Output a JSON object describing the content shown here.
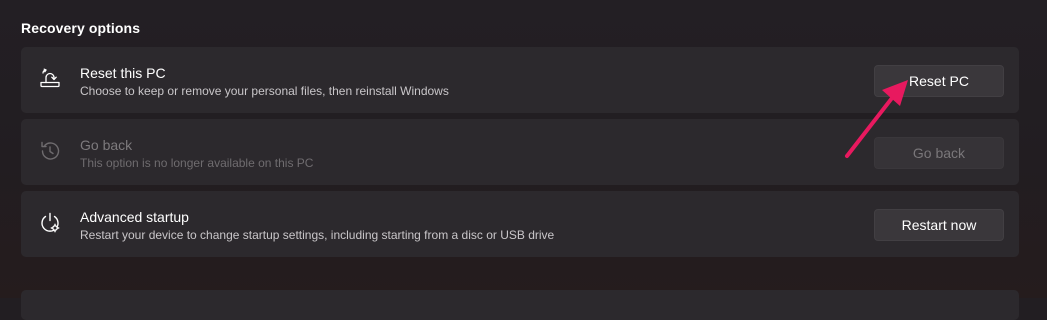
{
  "section": {
    "title": "Recovery options"
  },
  "options": [
    {
      "title": "Reset this PC",
      "description": "Choose to keep or remove your personal files, then reinstall Windows",
      "button_label": "Reset PC",
      "icon": "reset-pc-icon",
      "enabled": true
    },
    {
      "title": "Go back",
      "description": "This option is no longer available on this PC",
      "button_label": "Go back",
      "icon": "history-icon",
      "enabled": false
    },
    {
      "title": "Advanced startup",
      "description": "Restart your device to change startup settings, including starting from a disc or USB drive",
      "button_label": "Restart now",
      "icon": "advanced-startup-icon",
      "enabled": true
    }
  ],
  "annotation": {
    "icon": "pointer-arrow",
    "color": "#e8195f"
  },
  "colors": {
    "background": "#221e22",
    "card": "#2c292d",
    "button": "#3a373b"
  }
}
